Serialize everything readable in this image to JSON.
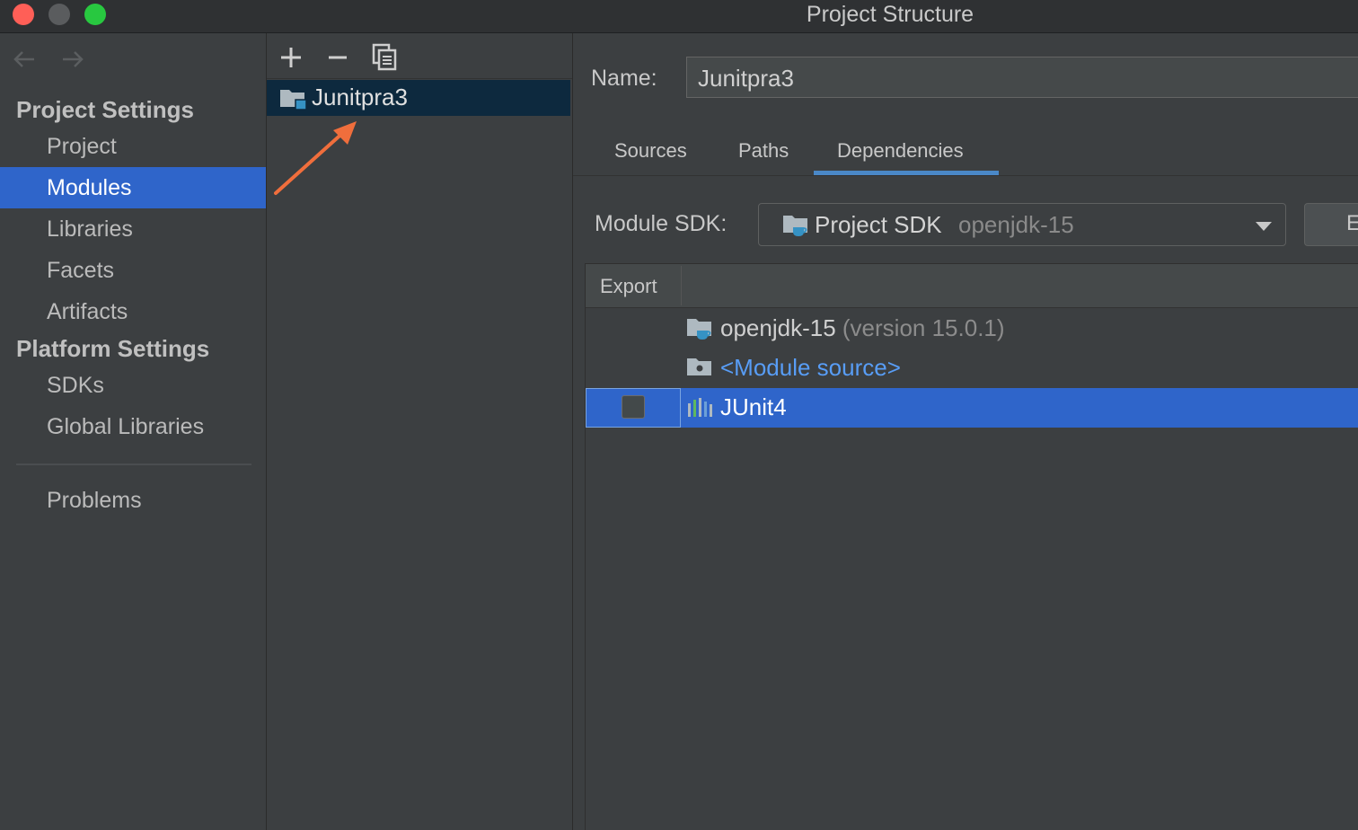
{
  "window": {
    "title": "Project Structure"
  },
  "sidebar": {
    "project_settings_title": "Project Settings",
    "platform_settings_title": "Platform Settings",
    "items": [
      {
        "label": "Project"
      },
      {
        "label": "Modules"
      },
      {
        "label": "Libraries"
      },
      {
        "label": "Facets"
      },
      {
        "label": "Artifacts"
      },
      {
        "label": "SDKs"
      },
      {
        "label": "Global Libraries"
      },
      {
        "label": "Problems"
      }
    ],
    "selected": "Modules"
  },
  "middle": {
    "modules": [
      {
        "name": "Junitpra3"
      }
    ],
    "toolbar": {
      "add_icon": "plus-icon",
      "remove_icon": "minus-icon",
      "copy_icon": "copy-icon"
    }
  },
  "main": {
    "name_label": "Name:",
    "name_value": "Junitpra3",
    "tabs": [
      {
        "label": "Sources"
      },
      {
        "label": "Paths"
      },
      {
        "label": "Dependencies"
      }
    ],
    "active_tab": "Dependencies",
    "sdk_label": "Module SDK:",
    "sdk_main": "Project SDK",
    "sdk_sub": "openjdk-15",
    "edit_button_label": "E",
    "table": {
      "export_header": "Export",
      "rows": [
        {
          "name": "openjdk-15",
          "detail": "(version 15.0.1)"
        },
        {
          "name": "<Module source>"
        },
        {
          "name": "JUnit4",
          "exported": false
        }
      ]
    }
  },
  "colors": {
    "selection": "#2f65ca",
    "annotation_arrow": "#f06e3c",
    "link": "#589df6",
    "tab_underline": "#4a88c7"
  }
}
